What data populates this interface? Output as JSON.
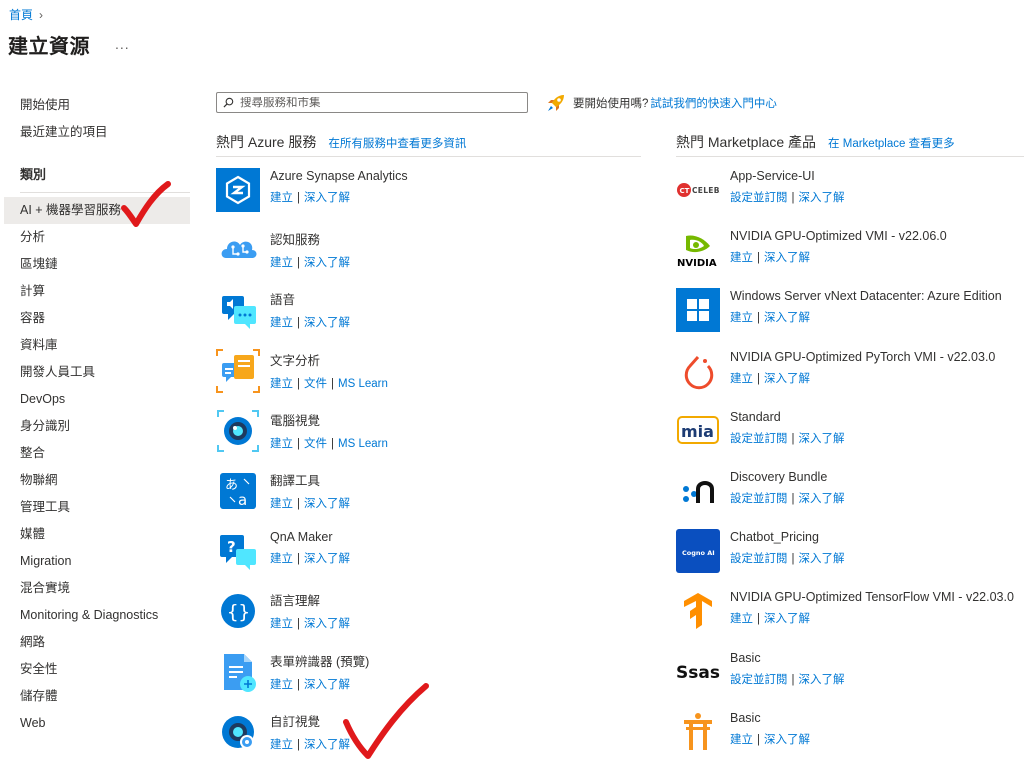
{
  "breadcrumb": {
    "home": "首頁"
  },
  "page": {
    "title": "建立資源",
    "more": "..."
  },
  "nav": {
    "top_items": [
      "開始使用",
      "最近建立的項目"
    ],
    "category_heading": "類別",
    "categories": [
      "AI + 機器學習服務",
      "分析",
      "區塊鏈",
      "計算",
      "容器",
      "資料庫",
      "開發人員工具",
      "DevOps",
      "身分識別",
      "整合",
      "物聯網",
      "管理工具",
      "媒體",
      "Migration",
      "混合實境",
      "Monitoring & Diagnostics",
      "網路",
      "安全性",
      "儲存體",
      "Web"
    ],
    "selected": "AI + 機器學習服務"
  },
  "search": {
    "placeholder": "搜尋服務和市集"
  },
  "quickstart": {
    "text": "要開始使用嗎?",
    "link": "試試我們的快速入門中心"
  },
  "azure": {
    "title": "熱門 Azure 服務",
    "link": "在所有服務中查看更多資訊",
    "items": [
      {
        "name": "Azure Synapse Analytics",
        "icon": "synapse-icon",
        "actions": [
          "建立",
          "深入了解"
        ]
      },
      {
        "name": "認知服務",
        "icon": "cognitive-services-icon",
        "actions": [
          "建立",
          "深入了解"
        ]
      },
      {
        "name": "語音",
        "icon": "speech-icon",
        "actions": [
          "建立",
          "深入了解"
        ]
      },
      {
        "name": "文字分析",
        "icon": "text-analytics-icon",
        "actions": [
          "建立",
          "文件",
          "MS Learn"
        ]
      },
      {
        "name": "電腦視覺",
        "icon": "computer-vision-icon",
        "actions": [
          "建立",
          "文件",
          "MS Learn"
        ]
      },
      {
        "name": "翻譯工具",
        "icon": "translator-icon",
        "actions": [
          "建立",
          "深入了解"
        ]
      },
      {
        "name": "QnA Maker",
        "icon": "qna-maker-icon",
        "actions": [
          "建立",
          "深入了解"
        ]
      },
      {
        "name": "語言理解",
        "icon": "language-understanding-icon",
        "actions": [
          "建立",
          "深入了解"
        ]
      },
      {
        "name": "表單辨識器 (預覽)",
        "icon": "form-recognizer-icon",
        "actions": [
          "建立",
          "深入了解"
        ]
      },
      {
        "name": "自訂視覺",
        "icon": "custom-vision-icon",
        "actions": [
          "建立",
          "深入了解"
        ]
      }
    ]
  },
  "marketplace": {
    "title": "熱門 Marketplace 產品",
    "link": "在 Marketplace 查看更多",
    "items": [
      {
        "name": "App-Service-UI",
        "icon": "celebal-logo-icon",
        "actions": [
          "設定並訂閱",
          "深入了解"
        ]
      },
      {
        "name": "NVIDIA GPU-Optimized VMI - v22.06.0",
        "icon": "nvidia-logo-icon",
        "actions": [
          "建立",
          "深入了解"
        ]
      },
      {
        "name": "Windows Server vNext Datacenter: Azure Edition",
        "icon": "windows-logo-icon",
        "actions": [
          "建立",
          "深入了解"
        ]
      },
      {
        "name": "NVIDIA GPU-Optimized PyTorch VMI - v22.03.0",
        "icon": "pytorch-logo-icon",
        "actions": [
          "建立",
          "深入了解"
        ]
      },
      {
        "name": "Standard",
        "icon": "mia-logo-icon",
        "actions": [
          "設定並訂閱",
          "深入了解"
        ]
      },
      {
        "name": "Discovery Bundle",
        "icon": "discovery-logo-icon",
        "actions": [
          "設定並訂閱",
          "深入了解"
        ]
      },
      {
        "name": "Chatbot_Pricing",
        "icon": "cogno-ai-logo-icon",
        "actions": [
          "設定並訂閱",
          "深入了解"
        ]
      },
      {
        "name": "NVIDIA GPU-Optimized TensorFlow VMI - v22.03.0",
        "icon": "tensorflow-logo-icon",
        "actions": [
          "建立",
          "深入了解"
        ]
      },
      {
        "name": "Basic",
        "icon": "sas-logo-icon",
        "actions": [
          "設定並訂閱",
          "深入了解"
        ]
      },
      {
        "name": "Basic",
        "icon": "torii-logo-icon",
        "actions": [
          "建立",
          "深入了解"
        ]
      }
    ]
  },
  "logos": {
    "celebal": "CT CELEBAL",
    "nvidia": "NVIDIA",
    "mia": "mia",
    "cogno": "Cogno AI",
    "sas": "sas"
  },
  "colors": {
    "link": "#0078d4",
    "annotation": "#e0191b"
  }
}
